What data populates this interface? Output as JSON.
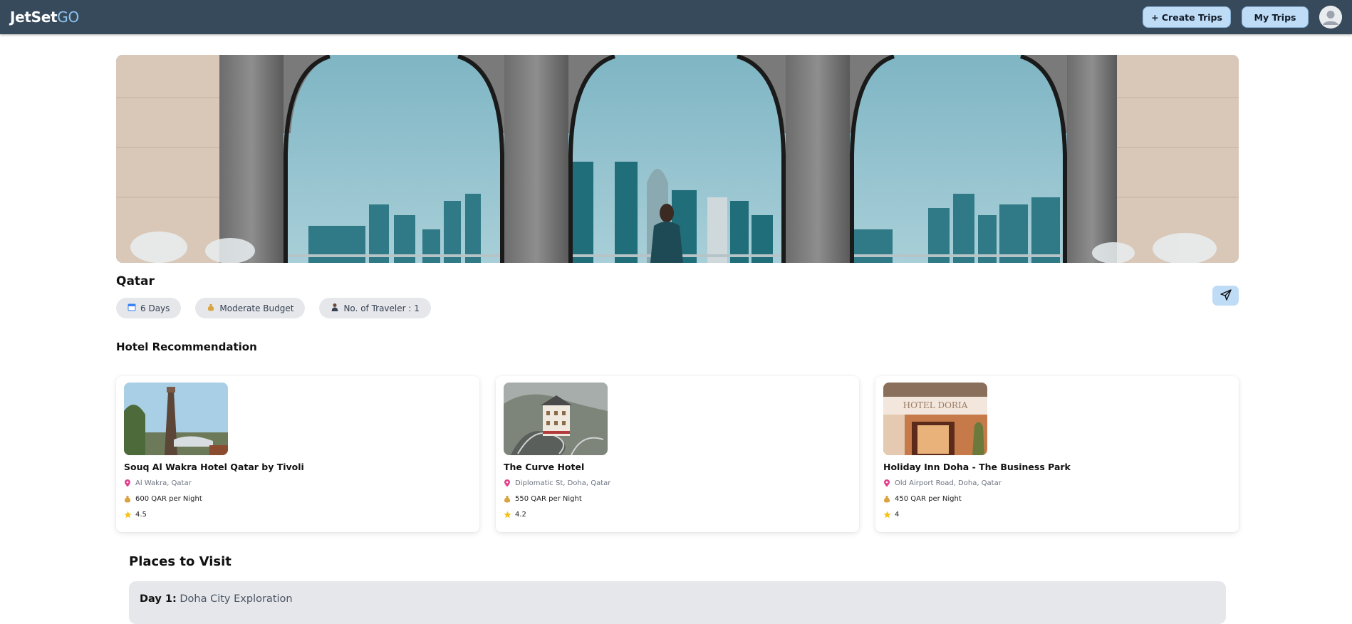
{
  "header": {
    "logo_part1": "JetSet",
    "logo_part2": "GO",
    "create_trips_label": "+ Create Trips",
    "my_trips_label": "My Trips",
    "avatar_icon": "user-avatar-icon"
  },
  "trip": {
    "destination": "Qatar",
    "days_label": "6 Days",
    "budget_label": "Moderate Budget",
    "travelers_label": "No. of Traveler : 1"
  },
  "hotels": {
    "title": "Hotel Recommendation",
    "items": [
      {
        "name": "Souq Al Wakra Hotel Qatar by Tivoli",
        "address": "Al Wakra, Qatar",
        "price": "600 QAR per Night",
        "rating": "4.5"
      },
      {
        "name": "The Curve Hotel",
        "address": "Diplomatic St, Doha, Qatar",
        "price": "550 QAR per Night",
        "rating": "4.2"
      },
      {
        "name": "Holiday Inn Doha - The Business Park",
        "address": "Old Airport Road, Doha, Qatar",
        "price": "450 QAR per Night",
        "rating": "4"
      }
    ]
  },
  "places": {
    "title": "Places to Visit",
    "day_label": "Day 1:",
    "day_title": "Doha City Exploration"
  },
  "images": {
    "hotel3_sign": "HOTEL DORIA"
  },
  "colors": {
    "header_bg": "#374a5c",
    "button_bg": "#bfdcf7",
    "chip_bg": "#e5e7eb"
  }
}
